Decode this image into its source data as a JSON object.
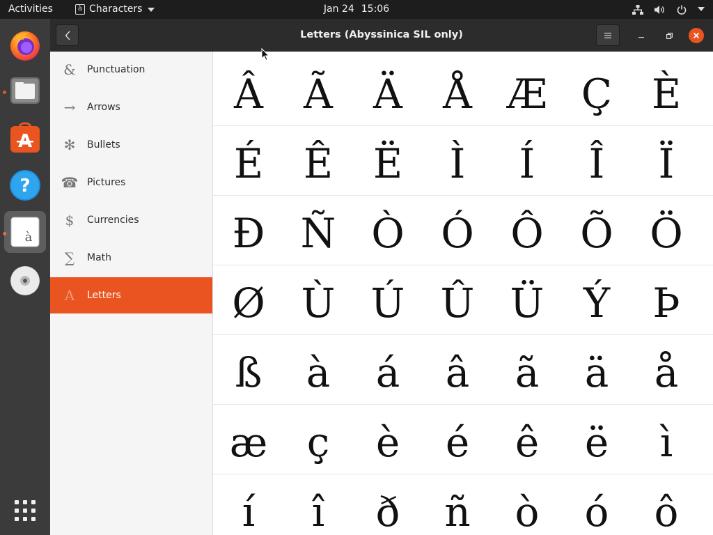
{
  "topbar": {
    "activities": "Activities",
    "app_name": "Characters",
    "app_icon_glyph": "à",
    "date": "Jan 24",
    "time": "15:06",
    "tray_icons": [
      "network-icon",
      "volume-icon",
      "power-icon",
      "chevron-down-icon"
    ]
  },
  "dock": {
    "items": [
      "firefox-icon",
      "files-icon",
      "software-icon",
      "help-icon",
      "characters-icon",
      "disc-icon",
      "show-apps-icon"
    ],
    "characters_icon_glyph": "à",
    "software_icon_glyph": "A",
    "help_icon_glyph": "?"
  },
  "window": {
    "title": "Letters (Abyssinica SIL only)",
    "accent": "#e95420"
  },
  "sidebar": {
    "items": [
      {
        "icon": "&",
        "label": "Punctuation"
      },
      {
        "icon": "→",
        "label": "Arrows"
      },
      {
        "icon": "✻",
        "label": "Bullets"
      },
      {
        "icon": "☎",
        "label": "Pictures"
      },
      {
        "icon": "$",
        "label": "Currencies"
      },
      {
        "icon": "∑",
        "label": "Math"
      },
      {
        "icon": "A",
        "label": "Letters"
      }
    ],
    "selected": "Letters"
  },
  "grid": {
    "rows": [
      [
        "Â",
        "Ã",
        "Ä",
        "Å",
        "Æ",
        "Ç",
        "È"
      ],
      [
        "É",
        "Ê",
        "Ë",
        "Ì",
        "Í",
        "Î",
        "Ï"
      ],
      [
        "Ð",
        "Ñ",
        "Ò",
        "Ó",
        "Ô",
        "Õ",
        "Ö"
      ],
      [
        "Ø",
        "Ù",
        "Ú",
        "Û",
        "Ü",
        "Ý",
        "Þ"
      ],
      [
        "ß",
        "à",
        "á",
        "â",
        "ã",
        "ä",
        "å"
      ],
      [
        "æ",
        "ç",
        "è",
        "é",
        "ê",
        "ë",
        "ì"
      ],
      [
        "í",
        "î",
        "ð",
        "ñ",
        "ò",
        "ó",
        "ô"
      ]
    ]
  }
}
